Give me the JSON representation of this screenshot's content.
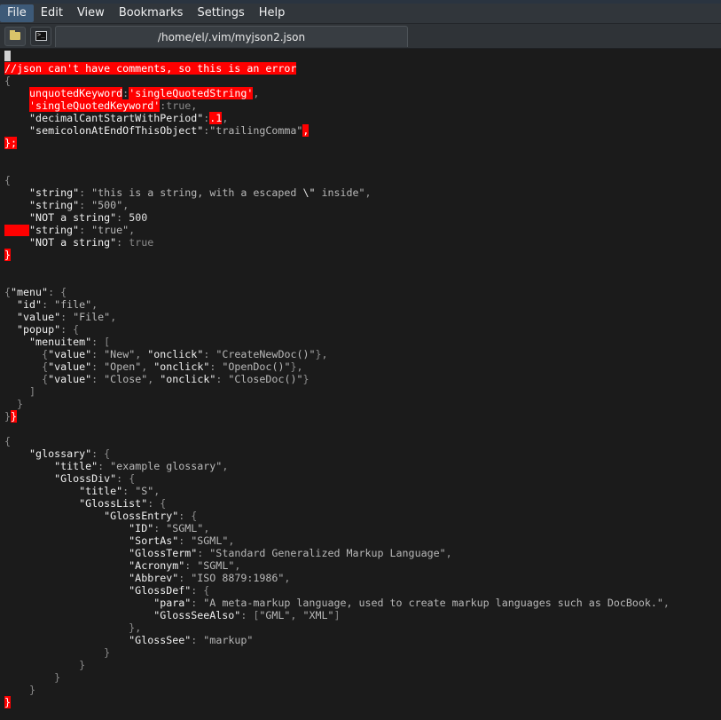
{
  "menu": {
    "file": "File",
    "edit": "Edit",
    "view": "View",
    "bookmarks": "Bookmarks",
    "settings": "Settings",
    "help": "Help"
  },
  "toolbar": {
    "new_tab_icon": "new-tab-folder-icon",
    "terminal_icon": "terminal-icon"
  },
  "tab": {
    "title": "/home/el/.vim/myjson2.json"
  },
  "colors": {
    "error_bg": "#ff0000",
    "editor_bg": "#1b1b1b",
    "menu_bg": "#31363b"
  },
  "editor": {
    "lines": {
      "comment": "//json can't have comments, so this is an error",
      "b1_open": "{",
      "b1_l1_key": "unquotedKeyword",
      "b1_l1_colon": ":",
      "b1_l1_val": "'singleQuotedString'",
      "b1_l1_comma": ",",
      "b1_l2_key": "'singleQuotedKeyword'",
      "b1_l2_colon": ":",
      "b1_l2_val": "true",
      "b1_l2_comma": ",",
      "b1_l3_key": "\"decimalCantStartWithPeriod\"",
      "b1_l3_colon": ":",
      "b1_l3_val": ".1",
      "b1_l3_comma": ",",
      "b1_l4_key": "\"semicolonAtEndOfThisObject\"",
      "b1_l4_colon": ":",
      "b1_l4_val": "\"trailingComma\"",
      "b1_l4_comma": ",",
      "b1_close": "};",
      "b2_open": "{",
      "b2_l1_key": "\"string\"",
      "b2_l1_val_a": "\"this is a string, with a escaped ",
      "b2_l1_esc": "\\\"",
      "b2_l1_val_b": " inside\"",
      "b2_l2_key": "\"string\"",
      "b2_l2_val": "\"500\"",
      "b2_l3_key": "\"NOT a string\"",
      "b2_l3_val": "500",
      "b2_l4_key": "\"string\"",
      "b2_l4_val": "\"true\"",
      "b2_l5_key": "\"NOT a string\"",
      "b2_l5_val": "true",
      "b2_close": "}",
      "m_menu_key": "\"menu\"",
      "m_id_key": "\"id\"",
      "m_id_val": "\"file\"",
      "m_value_key": "\"value\"",
      "m_value_val": "\"File\"",
      "m_popup_key": "\"popup\"",
      "m_menuitem_key": "\"menuitem\"",
      "m_i1_vk": "\"value\"",
      "m_i1_vv": "\"New\"",
      "m_i1_ok": "\"onclick\"",
      "m_i1_ov": "\"CreateNewDoc()\"",
      "m_i2_vk": "\"value\"",
      "m_i2_vv": "\"Open\"",
      "m_i2_ok": "\"onclick\"",
      "m_i2_ov": "\"OpenDoc()\"",
      "m_i3_vk": "\"value\"",
      "m_i3_vv": "\"Close\"",
      "m_i3_ok": "\"onclick\"",
      "m_i3_ov": "\"CloseDoc()\"",
      "m_close_err": "}",
      "g_glossary": "\"glossary\"",
      "g_title_k": "\"title\"",
      "g_title_v": "\"example glossary\"",
      "g_glossdiv": "\"GlossDiv\"",
      "g_gd_title_k": "\"title\"",
      "g_gd_title_v": "\"S\"",
      "g_glosslist": "\"GlossList\"",
      "g_glossentry": "\"GlossEntry\"",
      "g_id_k": "\"ID\"",
      "g_id_v": "\"SGML\"",
      "g_sortas_k": "\"SortAs\"",
      "g_sortas_v": "\"SGML\"",
      "g_term_k": "\"GlossTerm\"",
      "g_term_v": "\"Standard Generalized Markup Language\"",
      "g_acr_k": "\"Acronym\"",
      "g_acr_v": "\"SGML\"",
      "g_abbr_k": "\"Abbrev\"",
      "g_abbr_v": "\"ISO 8879:1986\"",
      "g_def_k": "\"GlossDef\"",
      "g_para_k": "\"para\"",
      "g_para_v": "\"A meta-markup language, used to create markup languages such as DocBook.\"",
      "g_seealso_k": "\"GlossSeeAlso\"",
      "g_seealso_v1": "\"GML\"",
      "g_seealso_v2": "\"XML\"",
      "g_see_k": "\"GlossSee\"",
      "g_see_v": "\"markup\"",
      "g_close_err": "}"
    }
  }
}
